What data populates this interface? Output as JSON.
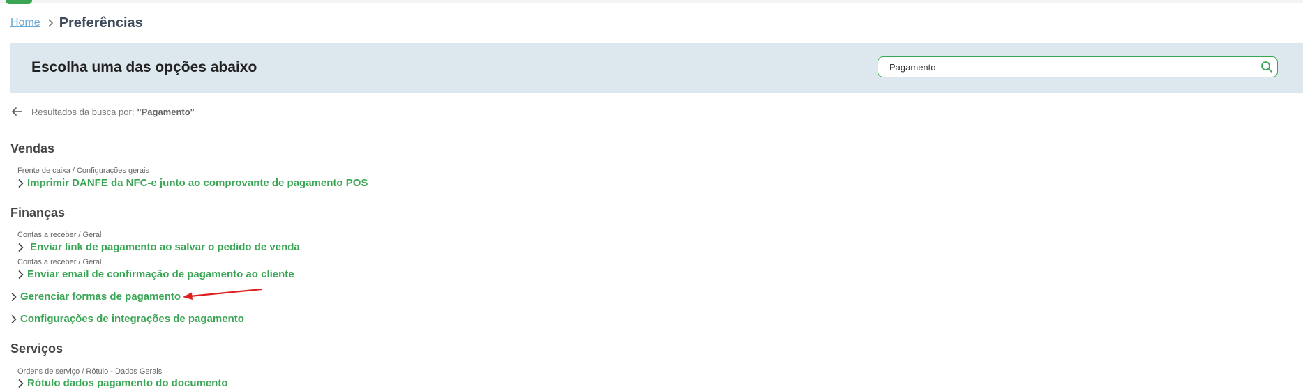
{
  "breadcrumb": {
    "home": "Home",
    "current": "Preferências"
  },
  "banner": {
    "title": "Escolha uma das opções abaixo"
  },
  "search": {
    "value": "Pagamento",
    "icon": "search-icon"
  },
  "results": {
    "prefix": "Resultados da busca por:",
    "query": "\"Pagamento\""
  },
  "sections": [
    {
      "title": "Vendas",
      "entries": [
        {
          "path": "Frente de caixa / Configurações gerais",
          "label": "Imprimir DANFE da NFC-e junto ao comprovante de pagamento POS"
        }
      ]
    },
    {
      "title": "Finanças",
      "entries": [
        {
          "path": "Contas a receber / Geral",
          "label": "Enviar link de pagamento ao salvar o pedido de venda"
        },
        {
          "path": "Contas a receber / Geral",
          "label": "Enviar email de confirmação de pagamento ao cliente"
        },
        {
          "path": "",
          "label": "Gerenciar formas de pagamento"
        },
        {
          "path": "",
          "label": "Configurações de integrações de pagamento"
        }
      ]
    },
    {
      "title": "Serviços",
      "entries": [
        {
          "path": "Ordens de serviço / Rótulo - Dados Gerais",
          "label": "Rótulo dados pagamento do documento"
        }
      ]
    }
  ],
  "colors": {
    "accent": "#3aa655",
    "banner_bg": "#dde8ee",
    "link": "#6ba9d6",
    "annotation_arrow": "#e02020"
  }
}
